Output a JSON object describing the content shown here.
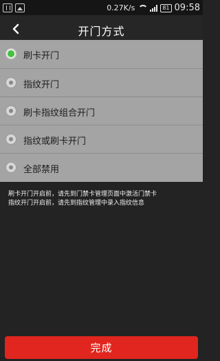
{
  "status_bar": {
    "net_speed": "0.27K/s",
    "battery": "81",
    "time": "09:58",
    "icons": [
      "usb-icon",
      "image-icon",
      "wifi-icon",
      "signal-icon",
      "battery-icon"
    ]
  },
  "header": {
    "title": "开门方式",
    "back_icon": "back-arrow-icon"
  },
  "options": [
    {
      "label": "刷卡开门",
      "selected": true
    },
    {
      "label": "指纹开门",
      "selected": false
    },
    {
      "label": "刷卡指纹组合开门",
      "selected": false
    },
    {
      "label": "指纹或刷卡开门",
      "selected": false
    },
    {
      "label": "全部禁用",
      "selected": false
    }
  ],
  "notes": [
    "刷卡开门开启前，请先到门禁卡管理页面中激活门禁卡",
    "指纹开门开启前，请先到指纹管理中录入指纹信息"
  ],
  "footer": {
    "done_label": "完成"
  },
  "colors": {
    "accent_red": "#e0261e",
    "selected_green": "#46c23d",
    "options_bg": "#a4a4a4",
    "page_bg": "#232323"
  }
}
